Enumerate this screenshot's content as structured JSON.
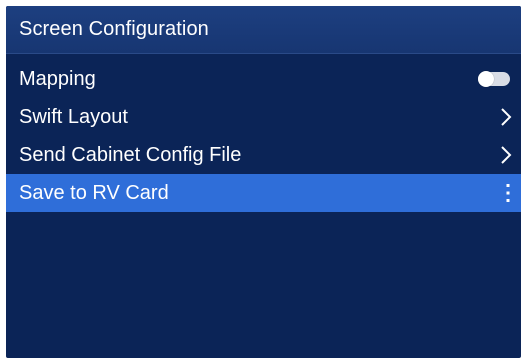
{
  "header": {
    "title": "Screen Configuration"
  },
  "menu": {
    "items": [
      {
        "label": "Mapping",
        "control": "toggle",
        "toggle_on": false
      },
      {
        "label": "Swift Layout",
        "control": "chevron-right-icon"
      },
      {
        "label": "Send Cabinet Config File",
        "control": "chevron-right-icon"
      },
      {
        "label": "Save to RV Card",
        "control": "more-vertical-icon",
        "selected": true
      }
    ]
  },
  "colors": {
    "panel_background": "#0b2457",
    "header_background": "#1d3f80",
    "selected_row": "#2f6ed9",
    "text": "#ffffff"
  }
}
